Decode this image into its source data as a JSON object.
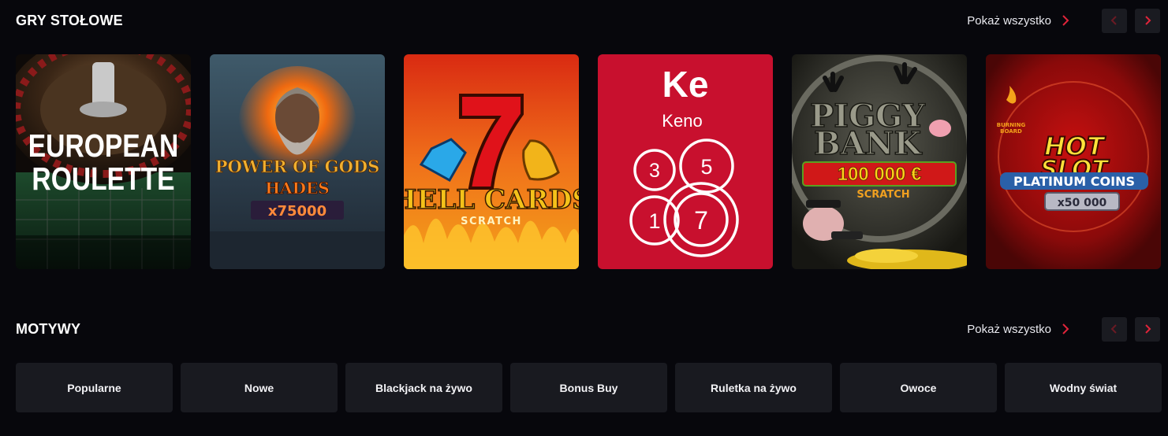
{
  "colors": {
    "background": "#07070c",
    "accent": "#e0243a",
    "panel": "#191a20"
  },
  "table_games": {
    "title": "GRY STOŁOWE",
    "show_all": "Pokaż wszystko",
    "games": [
      {
        "name": "European Roulette",
        "art_lines": [
          "EUROPEAN",
          "ROULETTE"
        ]
      },
      {
        "name": "Power of Gods Hades",
        "art_lines": [
          "POWER OF GODS",
          "HADES",
          "x75000"
        ]
      },
      {
        "name": "Hell Cards Scratch",
        "art_lines": [
          "HELL CARDS",
          "SCRATCH"
        ]
      },
      {
        "name": "Keno",
        "art_lines": [
          "Ke",
          "Keno",
          "3",
          "5",
          "1",
          "7"
        ]
      },
      {
        "name": "Piggy Bank Scratch",
        "art_lines": [
          "PIGGY",
          "BANK",
          "100 000 €",
          "SCRATCH"
        ]
      },
      {
        "name": "Hot Slot Platinum Coins",
        "art_lines": [
          "BURNING",
          "BOARD",
          "HOT",
          "SLOT",
          "PLATINUM COINS",
          "x50 000"
        ]
      }
    ]
  },
  "themes": {
    "title": "MOTYWY",
    "show_all": "Pokaż wszystko",
    "items": [
      "Popularne",
      "Nowe",
      "Blackjack na żywo",
      "Bonus Buy",
      "Ruletka na żywo",
      "Owoce",
      "Wodny świat"
    ]
  }
}
